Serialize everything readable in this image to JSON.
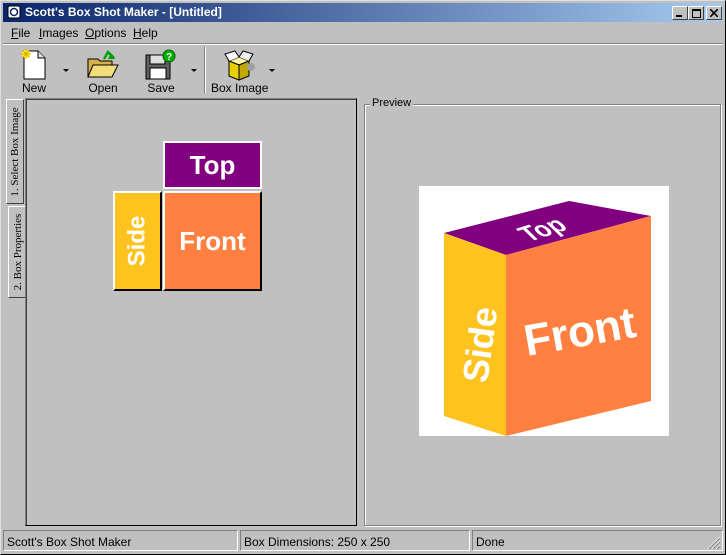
{
  "window": {
    "title": "Scott's Box Shot Maker - [Untitled]"
  },
  "menu": [
    {
      "label": "File",
      "accel": "F",
      "rest": "ile"
    },
    {
      "label": "Images",
      "accel": "I",
      "rest": "mages"
    },
    {
      "label": "Options",
      "accel": "O",
      "rest": "ptions"
    },
    {
      "label": "Help",
      "accel": "H",
      "rest": "elp"
    }
  ],
  "toolbar": {
    "new_label": "New",
    "open_label": "Open",
    "save_label": "Save",
    "box_image_label": "Box Image"
  },
  "side_tabs": {
    "tab1": "1. Select Box Image",
    "tab2": "2. Box Properties"
  },
  "faces": {
    "top": "Top",
    "side": "Side",
    "front": "Front"
  },
  "preview": {
    "label": "Preview",
    "top": "Top",
    "side": "Side",
    "front": "Front"
  },
  "colors": {
    "top": "#800080",
    "side": "#ffc31f",
    "front": "#ff8040",
    "title_start": "#0a246a",
    "title_end": "#a6caf0"
  },
  "statusbar": {
    "app": "Scott's Box Shot Maker",
    "dimensions": "Box Dimensions: 250 x 250",
    "state": "Done"
  }
}
